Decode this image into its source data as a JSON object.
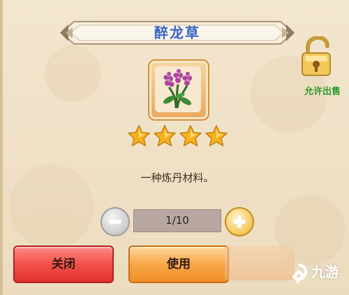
{
  "item": {
    "name": "醉龙草",
    "description": "一种炼丹材料。",
    "star_count": 4,
    "icon": "herb-flower-icon"
  },
  "lock": {
    "label": "允许出售",
    "icon": "unlocked-padlock-icon"
  },
  "quantity": {
    "display": "1/10",
    "minus_icon": "minus-icon",
    "plus_icon": "plus-icon"
  },
  "buttons": {
    "close_label": "关闭",
    "use_label": "使用"
  },
  "watermark": {
    "text": "九游",
    "icon": "9you-logo-icon"
  },
  "colors": {
    "title": "#3b64c4",
    "lock_label": "#2e9a2e",
    "close_button": "#f5544f",
    "use_button": "#f7a84a",
    "star": "#f6b21c"
  }
}
